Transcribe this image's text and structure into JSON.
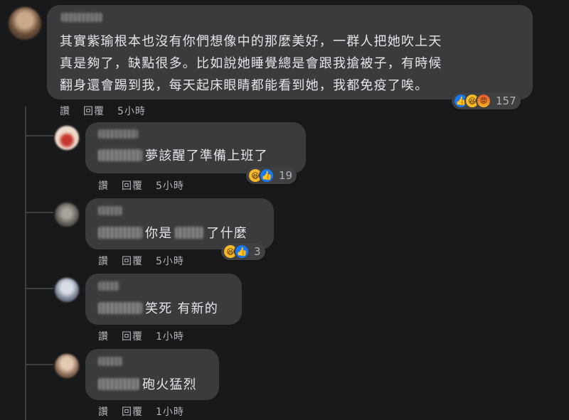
{
  "main_comment": {
    "lines": [
      "其實紫瑜根本也沒有你們想像中的那麼美好，一群人把她吹上天",
      "真是夠了，缺點很多。比如說她睡覺總是會跟我搶被子，有時候",
      "翻身還會踢到我，每天起床眼睛都能看到她，我都免疫了唉。"
    ],
    "actions": {
      "like": "讚",
      "reply": "回覆",
      "time": "5小時"
    },
    "reaction_count": "157"
  },
  "replies": [
    {
      "text": "夢該醒了準備上班了",
      "actions": {
        "like": "讚",
        "reply": "回覆",
        "time": "5小時"
      },
      "reaction_count": "19"
    },
    {
      "text_before": "你是",
      "text_after": "了什麼",
      "actions": {
        "like": "讚",
        "reply": "回覆",
        "time": "5小時"
      },
      "reaction_count": "3"
    },
    {
      "text": "笑死 有新的",
      "actions": {
        "like": "讚",
        "reply": "回覆",
        "time": "1小時"
      }
    },
    {
      "text": "砲火猛烈",
      "actions": {
        "like": "讚",
        "reply": "回覆",
        "time": "1小時"
      }
    }
  ],
  "icons": {
    "like": "👍",
    "haha": "😆",
    "angry": "😡"
  },
  "colors": {
    "background": "#18191a",
    "bubble": "#3a3b3c",
    "secondary_text": "#b0b3b8",
    "like_blue": "#1877f2"
  }
}
